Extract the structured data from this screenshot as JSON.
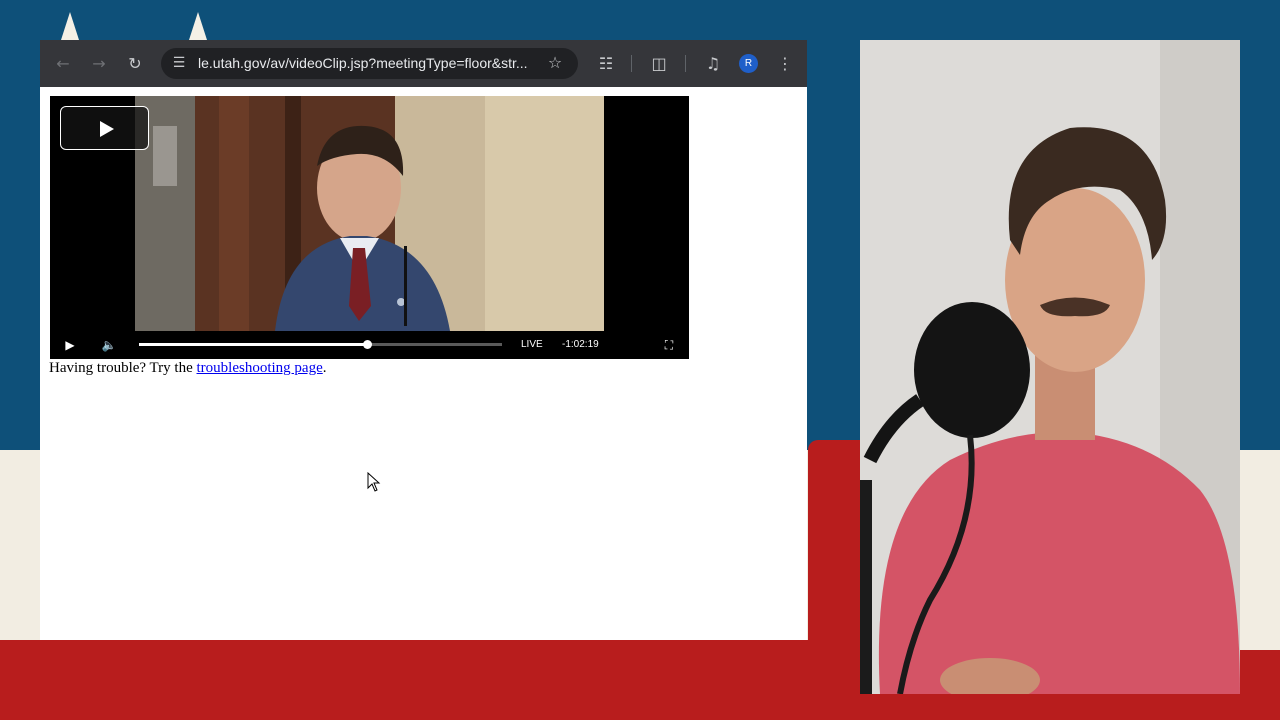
{
  "browser": {
    "address_bar": {
      "url": "le.utah.gov/av/videoClip.jsp?meetingType=floor&str..."
    },
    "profile_initial": "R",
    "icons": {
      "back": "back-arrow-icon",
      "forward": "forward-arrow-icon",
      "reload": "reload-icon",
      "site_info": "tune-icon",
      "bookmark": "star-icon",
      "extensions": "puzzle-icon",
      "cast": "cast-search-icon",
      "media": "media-control-icon",
      "menu": "kebab-menu-icon"
    }
  },
  "player": {
    "live_label": "LIVE",
    "time_remaining": "-1:02:19",
    "progress": 0.63,
    "icons": {
      "big_play": "play-icon",
      "play": "play-icon",
      "volume": "volume-icon",
      "fullscreen": "fullscreen-icon"
    }
  },
  "page": {
    "trouble_prefix": "Having trouble? Try the ",
    "trouble_link": "troubleshooting page",
    "trouble_suffix": "."
  },
  "colors": {
    "backdrop_blue": "#0e5079",
    "backdrop_cream": "#f2ede2",
    "backdrop_red": "#b81d1d",
    "toolbar": "#35363a",
    "link": "#0000ee"
  }
}
